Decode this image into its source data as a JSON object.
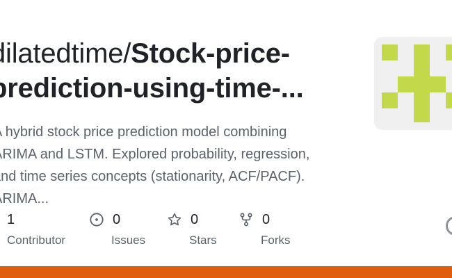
{
  "repo": {
    "title_line1_owner": "dilatedtime/",
    "title_line1_repo": "Stock-price-",
    "title_line2": "prediction-using-time-...",
    "description_lines": [
      "A hybrid stock price prediction model combining",
      "ARIMA and LSTM. Explored probability, regression,",
      "and time series concepts (stationarity, ACF/PACF).",
      "ARIMA..."
    ]
  },
  "stats": {
    "contributors": {
      "count": "1",
      "label": "Contributor"
    },
    "issues": {
      "count": "0",
      "label": "Issues",
      "icon": "issue-opened-icon"
    },
    "stars": {
      "count": "0",
      "label": "Stars",
      "icon": "star-icon"
    },
    "forks": {
      "count": "0",
      "label": "Forks",
      "icon": "fork-icon"
    }
  },
  "colors": {
    "avatar_bg": "#f0f0f0",
    "avatar_fg": "#c4d94a",
    "bottom_bar": "#e05d0d",
    "text_primary": "#1f2328",
    "text_muted": "#59636e"
  }
}
